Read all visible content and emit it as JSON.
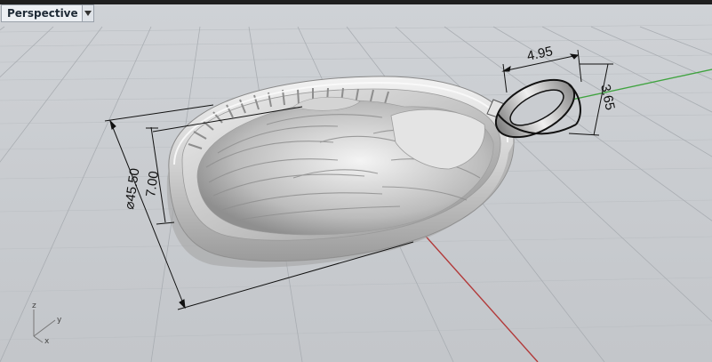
{
  "viewport": {
    "title": "Perspective",
    "menu_icon": "dropdown-arrow-icon"
  },
  "dimensions": {
    "bail_width": "4.95",
    "bail_height": "3.65",
    "pendant_diameter": "⌀45.50",
    "rim_height": "7.00"
  },
  "axes": {
    "z": "z",
    "y": "y",
    "x": "x"
  },
  "colors": {
    "grid_major": "#a9adb2",
    "grid_minor": "#bbbfc3",
    "x_axis": "#b23a3a",
    "y_axis": "#3fa33f",
    "model": "#d6d6d6"
  }
}
